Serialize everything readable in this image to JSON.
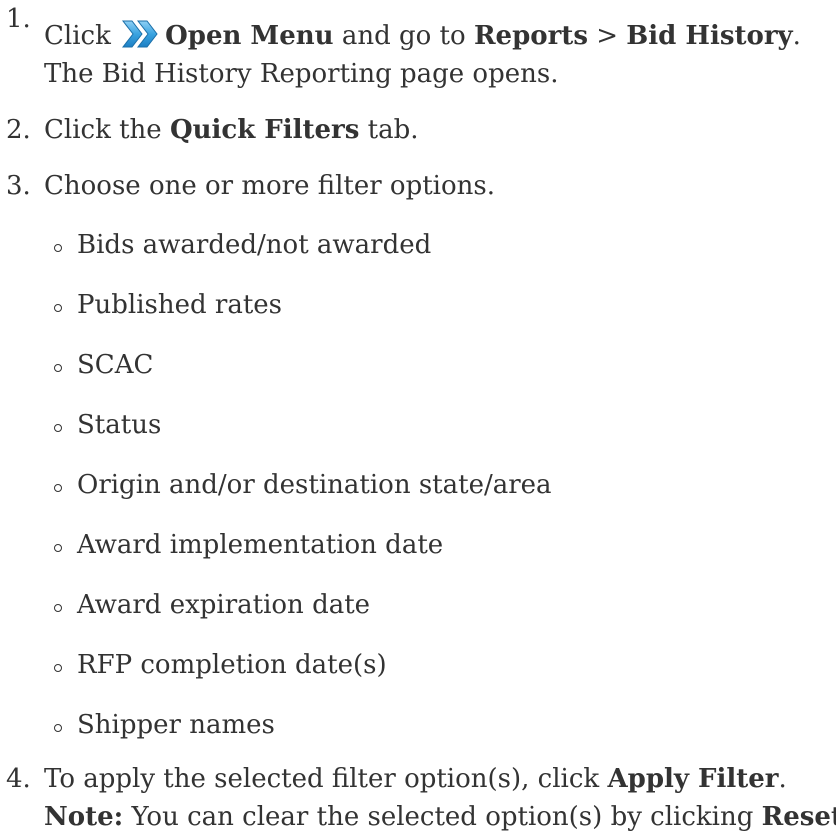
{
  "steps": [
    {
      "number": "1.",
      "text_1": "Click ",
      "icon": "double-chevron-right-icon",
      "bold_1": "Open Menu",
      "text_2": " and go to ",
      "bold_2": "Reports",
      "text_3": " > ",
      "bold_3": "Bid History",
      "text_4": ".",
      "line_2": "The Bid History Reporting page opens."
    },
    {
      "number": "2.",
      "text_1": "Click the ",
      "bold_1": "Quick Filters",
      "text_2": " tab."
    },
    {
      "number": "3.",
      "text_1": "Choose one or more filter options.",
      "options": [
        "Bids awarded/not awarded",
        "Published rates",
        "SCAC",
        "Status",
        "Origin and/or destination state/area",
        "Award implementation date",
        "Award expiration date",
        "RFP completion date(s)",
        "Shipper names"
      ]
    },
    {
      "number": "4.",
      "text_1": "To apply the selected filter option(s), click ",
      "bold_1": "Apply Filter",
      "text_2": ".",
      "note_label": "Note:",
      "note_text": " You can clear the selected option(s) by clicking ",
      "note_bold": "Reset",
      "note_end": "."
    }
  ]
}
